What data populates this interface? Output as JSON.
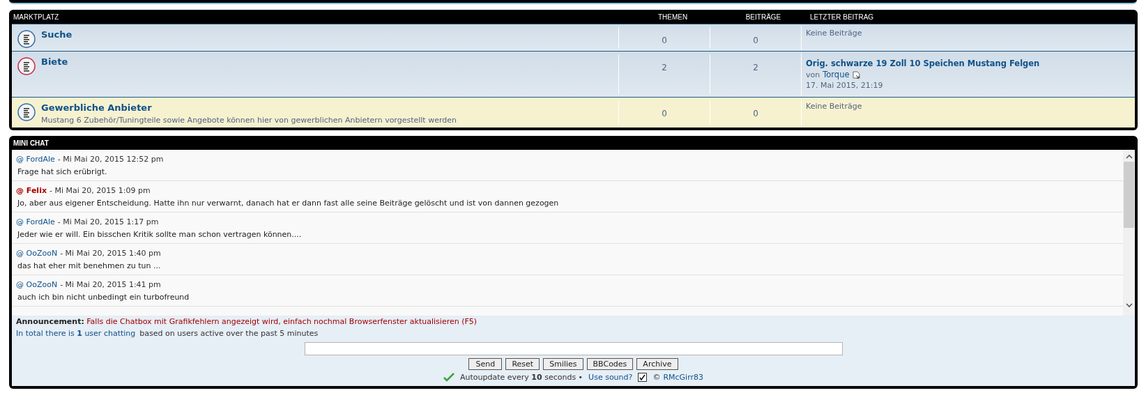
{
  "forum": {
    "title": "MARKTPLATZ",
    "columns": [
      "THEMEN",
      "BEITRÄGE",
      "LETZTER BEITRAG"
    ],
    "rows": [
      {
        "title": "Suche",
        "description": null,
        "color": "#2f6fa8",
        "highlighted": false,
        "topics": "0",
        "posts": "0",
        "last_post": {
          "kind": "none",
          "text": "Keine Beiträge"
        }
      },
      {
        "title": "Biete",
        "description": null,
        "color": "#c8284a",
        "highlighted": false,
        "topics": "2",
        "posts": "2",
        "last_post": {
          "kind": "post",
          "title": "Orig. schwarze 19 Zoll 10 Speichen Mustang Felgen",
          "by": "von",
          "author": "Torque",
          "date": "17. Mai 2015, 21:19"
        }
      },
      {
        "title": "Gewerbliche Anbieter",
        "description": "Mustang 6 Zubehör/Tuningteile sowie Angebote können hier von gewerblichen Anbietern vorgestellt werden",
        "color": "#2f6fa8",
        "highlighted": true,
        "topics": "0",
        "posts": "0",
        "last_post": {
          "kind": "none",
          "text": "Keine Beiträge"
        }
      }
    ]
  },
  "chat": {
    "title": "MINI CHAT",
    "messages": [
      {
        "at": "@",
        "user": "FordAle",
        "color": "#105289",
        "bold": false,
        "time": "- Mi Mai 20, 2015 12:52 pm",
        "text": "Frage hat sich erübrigt."
      },
      {
        "at": "@",
        "user": "Felix",
        "color": "#aa0000",
        "bold": true,
        "time": "- Mi Mai 20, 2015 1:09 pm",
        "text": "Jo, aber aus eigener Entscheidung. Hatte ihn nur verwarnt, danach hat er dann fast alle seine Beiträge gelöscht und ist von dannen gezogen"
      },
      {
        "at": "@",
        "user": "FordAle",
        "color": "#105289",
        "bold": false,
        "time": "- Mi Mai 20, 2015 1:17 pm",
        "text": "Jeder wie er will. Ein bisschen Kritik sollte man schon vertragen können...."
      },
      {
        "at": "@",
        "user": "OoZooN",
        "color": "#105289",
        "bold": false,
        "time": "- Mi Mai 20, 2015 1:40 pm",
        "text": "das hat eher mit benehmen zu tun ..."
      },
      {
        "at": "@",
        "user": "OoZooN",
        "color": "#105289",
        "bold": false,
        "time": "- Mi Mai 20, 2015 1:41 pm",
        "text": "auch ich bin nicht unbedingt ein turbofreund"
      }
    ],
    "announcement_label": "Announcement:",
    "announcement": "Falls die Chatbox mit Grafikfehlern angezeigt wird, einfach nochmal Browserfenster aktualisieren (F5)",
    "online": "In total there is **1** user chatting",
    "online_note": "based on users active over the past 5 minutes",
    "buttons": [
      "Send",
      "Reset",
      "Smilies",
      "BBCodes",
      "Archive"
    ],
    "autoupdate": "Autoupdate every **10** seconds •",
    "sound_label": "Use sound?",
    "sound": {
      "checked": true
    },
    "copyright": "©",
    "author": "RMcGirr83"
  }
}
